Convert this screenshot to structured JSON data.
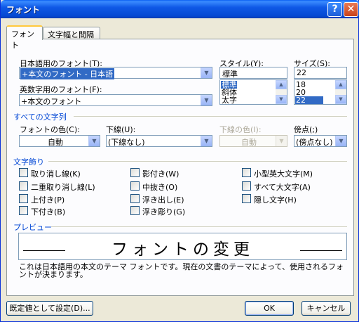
{
  "window": {
    "title": "フォント",
    "help_glyph": "?",
    "close_glyph": "✕"
  },
  "tabs": [
    {
      "label": "フォント",
      "active": true
    },
    {
      "label": "文字幅と間隔",
      "active": false
    }
  ],
  "fonts": {
    "japanese_label": "日本語用のフォント(T):",
    "japanese_value": "+本文のフォント - 日本語",
    "western_label": "英数字用のフォント(F):",
    "western_value": "+本文のフォント"
  },
  "style": {
    "label": "スタイル(Y):",
    "value": "標準",
    "options": [
      "標準",
      "斜体",
      "太字"
    ],
    "selected_index": 0
  },
  "size": {
    "label": "サイズ(S):",
    "value": "22",
    "options": [
      "18",
      "20",
      "22"
    ],
    "selected_index": 2
  },
  "all_text": {
    "section_label": "すべての文字列",
    "font_color_label": "フォントの色(C):",
    "font_color_value": "自動",
    "underline_label": "下線(U):",
    "underline_value": "(下線なし)",
    "underline_color_label": "下線の色(I):",
    "underline_color_value": "自動",
    "emphasis_label": "傍点(;)",
    "emphasis_value": "(傍点なし)"
  },
  "effects": {
    "section_label": "文字飾り",
    "col1": [
      "取り消し線(K)",
      "二重取り消し線(L)",
      "上付き(P)",
      "下付き(B)"
    ],
    "col2": [
      "影付き(W)",
      "中抜き(O)",
      "浮き出し(E)",
      "浮き彫り(G)"
    ],
    "col3": [
      "小型英大文字(M)",
      "すべて大文字(A)",
      "隠し文字(H)"
    ]
  },
  "preview": {
    "section_label": "プレビュー",
    "sample_text": "フォントの変更",
    "note": "これは日本語用の本文のテーマ フォントです。現在の文書のテーマによって、使用されるフォントが決まります。"
  },
  "buttons": {
    "set_default": "既定値として設定(D)...",
    "ok": "OK",
    "cancel": "キャンセル"
  }
}
